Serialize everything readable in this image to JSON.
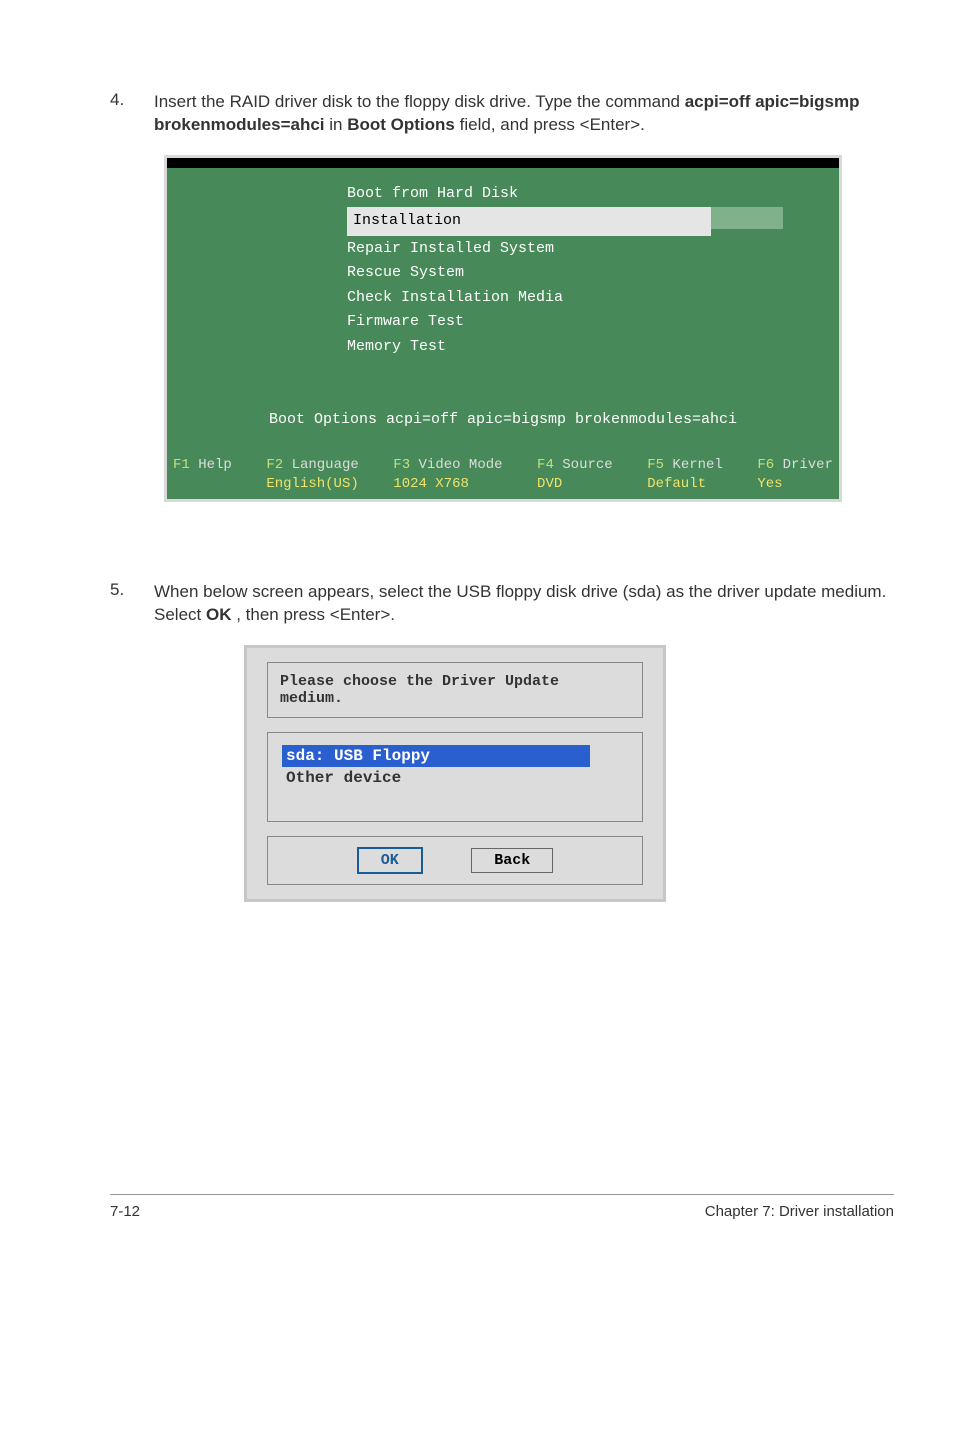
{
  "steps": {
    "s4": {
      "num": "4.",
      "text_before": "Insert the RAID driver disk to the floppy disk drive. Type the command ",
      "cmd": "acpi=off apic=bigsmp brokenmodules=ahci",
      "text_mid": " in ",
      "field": "Boot Options",
      "text_after": " field, and press <Enter>."
    },
    "s5": {
      "num": "5.",
      "text_before": "When below screen appears, select the USB floppy disk drive (sda) as the driver update medium. Select ",
      "btn": "OK",
      "text_after": ", then press <Enter>."
    }
  },
  "boot_menu": {
    "items": {
      "i0": "Boot from Hard Disk",
      "i1": "Installation",
      "i2": "Repair Installed System",
      "i3": "Rescue System",
      "i4": "Check Installation Media",
      "i5": "Firmware Test",
      "i6": "Memory Test"
    },
    "options_line": "Boot Options acpi=off apic=bigsmp brokenmodules=ahci",
    "fkeys": {
      "f1_key": "F1",
      "f1_label": "Help",
      "f2_key": "F2",
      "f2_label": "Language",
      "f2_val": "English(US)",
      "f3_key": "F3",
      "f3_label": "Video Mode",
      "f3_val": "1024 X768",
      "f4_key": "F4",
      "f4_label": "Source",
      "f4_val": "DVD",
      "f5_key": "F5",
      "f5_label": "Kernel",
      "f5_val": "Default",
      "f6_key": "F6",
      "f6_label": "Driver",
      "f6_val": "Yes"
    }
  },
  "dialog": {
    "title": "Please choose the Driver Update medium.",
    "items": {
      "sel": "sda: USB Floppy",
      "other": "Other device"
    },
    "ok": "OK",
    "back": "Back"
  },
  "footer": {
    "left": "7-12",
    "right": "Chapter 7: Driver installation"
  }
}
